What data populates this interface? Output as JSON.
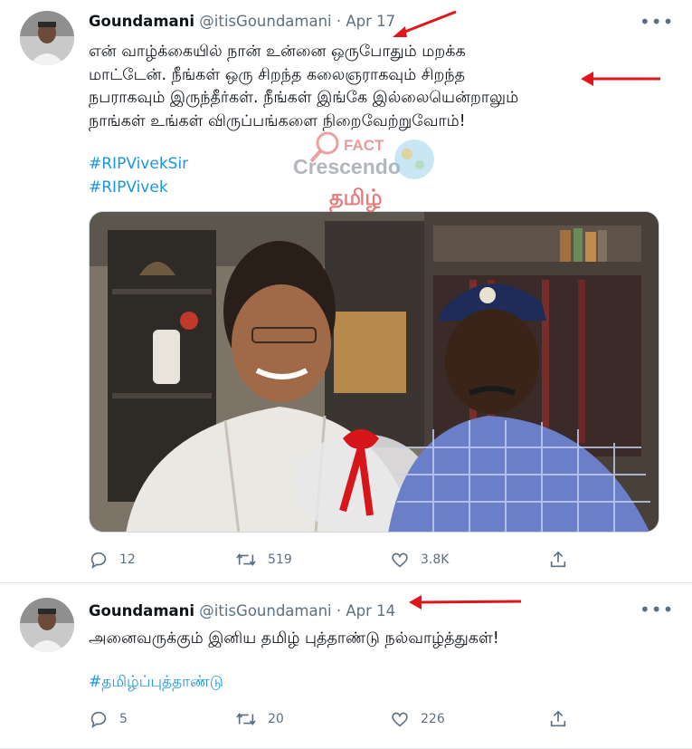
{
  "tweets": [
    {
      "author_name": "Goundamani",
      "author_handle": "@itisGoundamani",
      "separator": "·",
      "date": "Apr 17",
      "text_lines": [
        "என் வாழ்க்கையில் நான் உன்னை ஒருபோதும் மறக்க",
        "மாட்டேன். நீங்கள் ஒரு சிறந்த கலைஞராகவும் சிறந்த",
        "நபராகவும் இருந்தீர்கள். நீங்கள் இங்கே இல்லையென்றாலும்",
        "நாங்கள் உங்கள் விருப்பங்களை நிறைவேற்றுவோம்!"
      ],
      "hashtags": [
        "#RIPVivekSir",
        "#RIPVivek"
      ],
      "replies": "12",
      "retweets": "519",
      "likes": "3.8K",
      "more_icon": "ellipsis-icon"
    },
    {
      "author_name": "Goundamani",
      "author_handle": "@itisGoundamani",
      "separator": "·",
      "date": "Apr 14",
      "text_lines": [
        "அனைவருக்கும் இனிய தமிழ் புத்தாண்டு நல்வாழ்த்துகள்!"
      ],
      "hashtags": [
        "#தமிழ்ப்புத்தாண்டு"
      ],
      "replies": "5",
      "retweets": "20",
      "likes": "226",
      "more_icon": "ellipsis-icon"
    }
  ],
  "watermark": {
    "line1": "FACT",
    "line2": "Crescendo",
    "line3": "தமிழ்"
  },
  "colors": {
    "accent": "#1b95e0",
    "muted": "#5b7083",
    "annotation_arrow": "#e0161b"
  }
}
